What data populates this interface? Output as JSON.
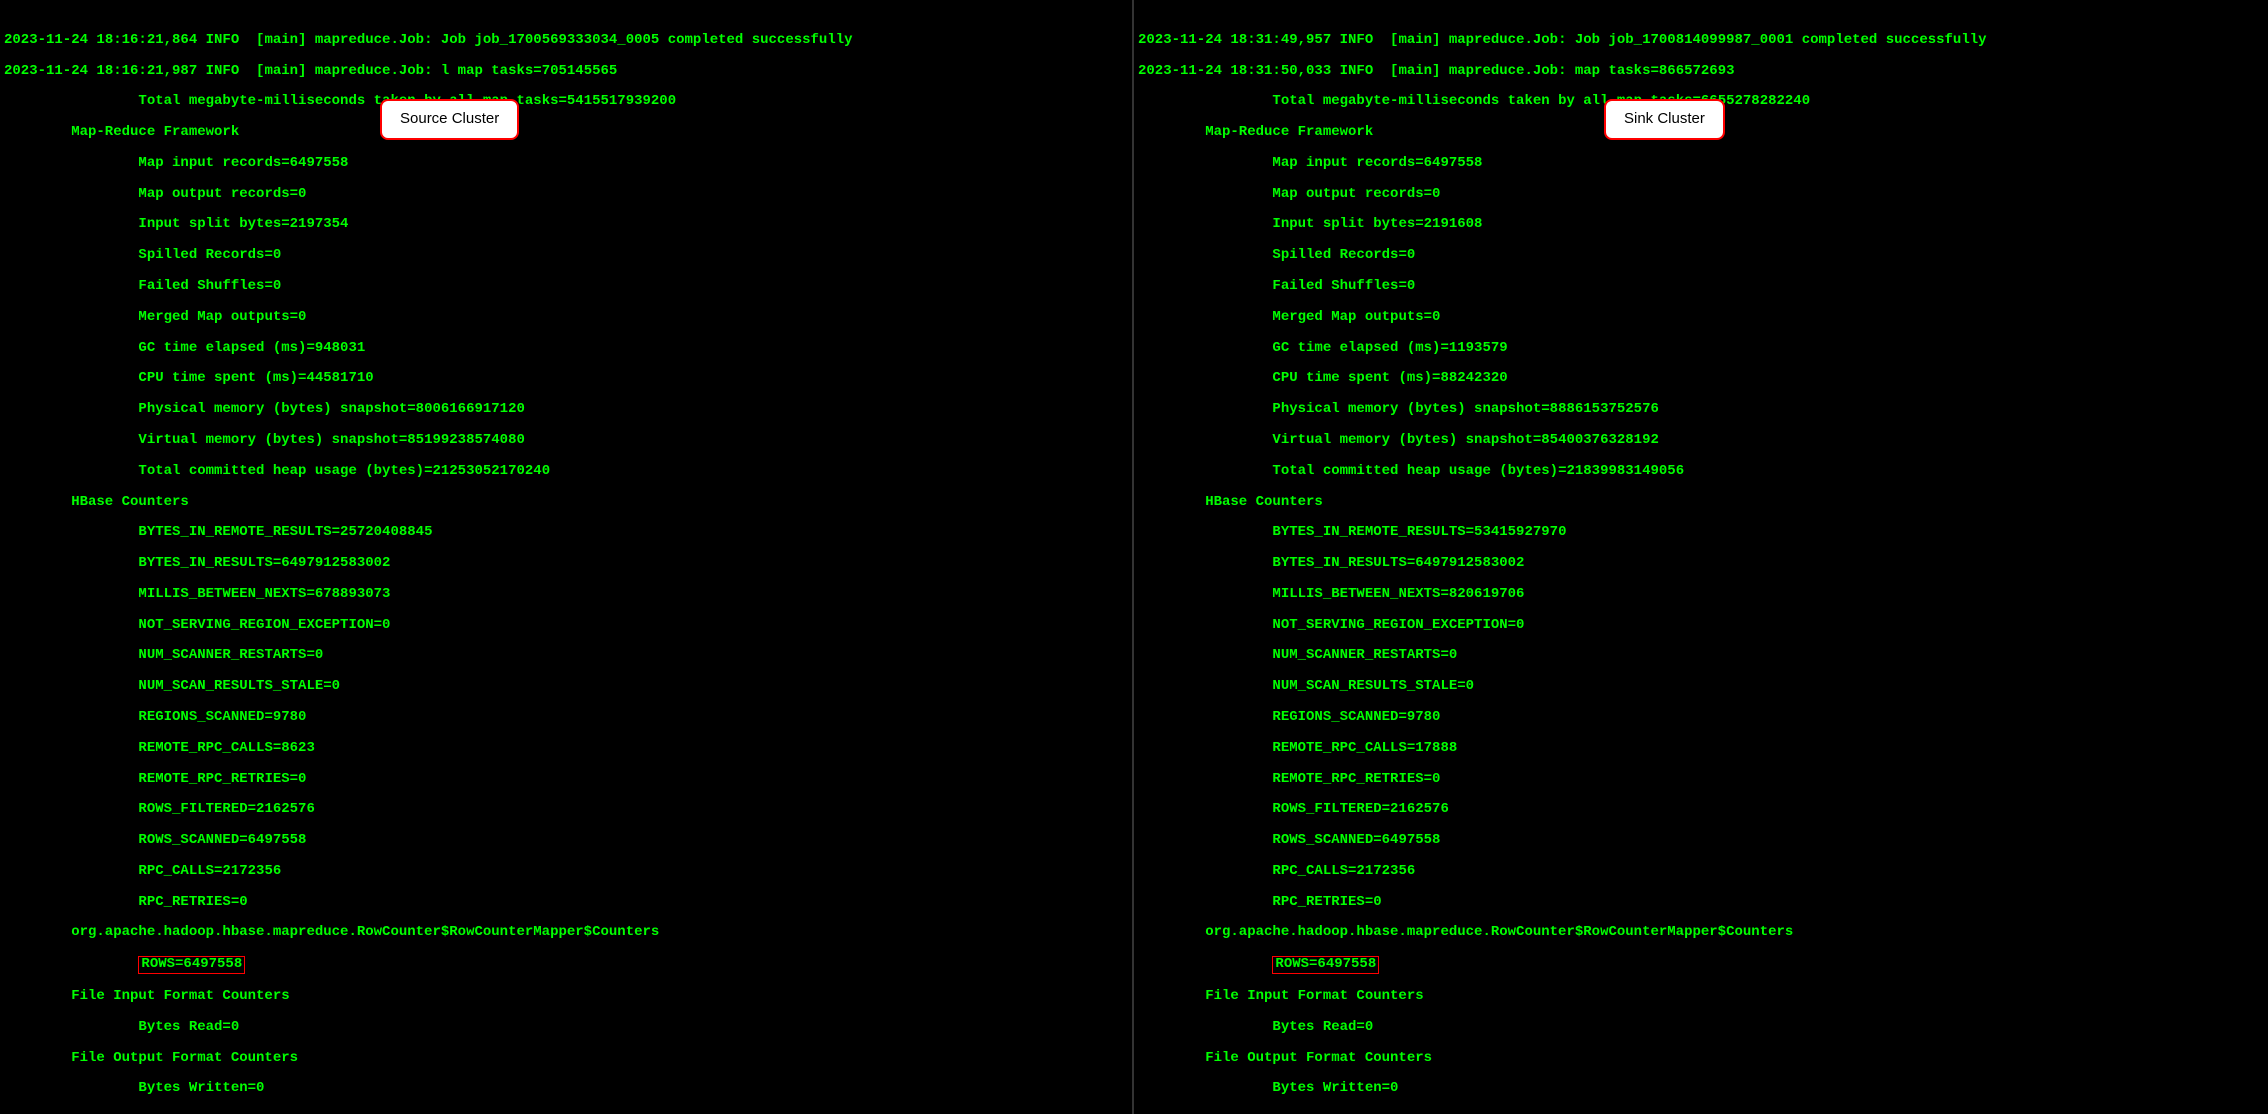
{
  "left": {
    "badge": "Source Cluster",
    "line1": "2023-11-24 18:16:21,864 INFO  [main] mapreduce.Job: Job job_1700569333034_0005 completed successfully",
    "line2": "2023-11-24 18:16:21,987 INFO  [main] mapreduce.Job: l map tasks=705145565",
    "total_mb_ms": "Total megabyte-milliseconds taken by all map tasks=5415517939200",
    "fw_header": "Map-Reduce Framework",
    "fw": {
      "map_in": "Map input records=6497558",
      "map_out": "Map output records=0",
      "split": "Input split bytes=2197354",
      "spilled": "Spilled Records=0",
      "failed": "Failed Shuffles=0",
      "merged": "Merged Map outputs=0",
      "gc": "GC time elapsed (ms)=948031",
      "cpu": "CPU time spent (ms)=44581710",
      "pmem": "Physical memory (bytes) snapshot=8006166917120",
      "vmem": "Virtual memory (bytes) snapshot=85199238574080",
      "heap": "Total committed heap usage (bytes)=21253052170240"
    },
    "hb_header": "HBase Counters",
    "hb": {
      "birr": "BYTES_IN_REMOTE_RESULTS=25720408845",
      "bir": "BYTES_IN_RESULTS=6497912583002",
      "mbn": "MILLIS_BETWEEN_NEXTS=678893073",
      "nsre": "NOT_SERVING_REGION_EXCEPTION=0",
      "nsr": "NUM_SCANNER_RESTARTS=0",
      "nsrs": "NUM_SCAN_RESULTS_STALE=0",
      "rs": "REGIONS_SCANNED=9780",
      "rrc": "REMOTE_RPC_CALLS=8623",
      "rrr": "REMOTE_RPC_RETRIES=0",
      "rf": "ROWS_FILTERED=2162576",
      "rsc": "ROWS_SCANNED=6497558",
      "rpc": "RPC_CALLS=2172356",
      "rpr": "RPC_RETRIES=0"
    },
    "rc_header": "org.apache.hadoop.hbase.mapreduce.RowCounter$RowCounterMapper$Counters",
    "rows": "ROWS=6497558",
    "fif_header": "File Input Format Counters",
    "bytes_read": "Bytes Read=0",
    "fof_header": "File Output Format Counters",
    "bytes_written": "Bytes Written=0"
  },
  "right": {
    "badge": "Sink Cluster",
    "line1": "2023-11-24 18:31:49,957 INFO  [main] mapreduce.Job: Job job_1700814099987_0001 completed successfully",
    "line2": "2023-11-24 18:31:50,033 INFO  [main] mapreduce.Job: map tasks=866572693",
    "total_mb_ms": "Total megabyte-milliseconds taken by all map tasks=6655278282240",
    "fw_header": "Map-Reduce Framework",
    "fw": {
      "map_in": "Map input records=6497558",
      "map_out": "Map output records=0",
      "split": "Input split bytes=2191608",
      "spilled": "Spilled Records=0",
      "failed": "Failed Shuffles=0",
      "merged": "Merged Map outputs=0",
      "gc": "GC time elapsed (ms)=1193579",
      "cpu": "CPU time spent (ms)=88242320",
      "pmem": "Physical memory (bytes) snapshot=8886153752576",
      "vmem": "Virtual memory (bytes) snapshot=85400376328192",
      "heap": "Total committed heap usage (bytes)=21839983149056"
    },
    "hb_header": "HBase Counters",
    "hb": {
      "birr": "BYTES_IN_REMOTE_RESULTS=53415927970",
      "bir": "BYTES_IN_RESULTS=6497912583002",
      "mbn": "MILLIS_BETWEEN_NEXTS=820619706",
      "nsre": "NOT_SERVING_REGION_EXCEPTION=0",
      "nsr": "NUM_SCANNER_RESTARTS=0",
      "nsrs": "NUM_SCAN_RESULTS_STALE=0",
      "rs": "REGIONS_SCANNED=9780",
      "rrc": "REMOTE_RPC_CALLS=17888",
      "rrr": "REMOTE_RPC_RETRIES=0",
      "rf": "ROWS_FILTERED=2162576",
      "rsc": "ROWS_SCANNED=6497558",
      "rpc": "RPC_CALLS=2172356",
      "rpr": "RPC_RETRIES=0"
    },
    "rc_header": "org.apache.hadoop.hbase.mapreduce.RowCounter$RowCounterMapper$Counters",
    "rows": "ROWS=6497558",
    "fif_header": "File Input Format Counters",
    "bytes_read": "Bytes Read=0",
    "fof_header": "File Output Format Counters",
    "bytes_written": "Bytes Written=0"
  }
}
